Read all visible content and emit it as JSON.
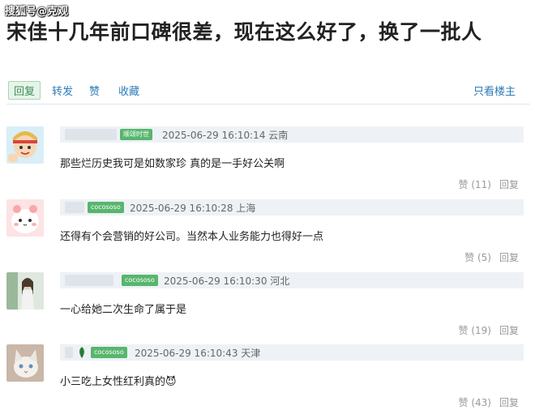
{
  "watermark": "搜狐号@克观",
  "article": {
    "title": "宋佳十几年前口碑很差，现在这么好了，换了一批人"
  },
  "actions": {
    "reply": "回复",
    "forward": "转发",
    "like": "赞",
    "favorite": "收藏",
    "only_op": "只看楼主"
  },
  "comments": [
    {
      "tag": "顺颂时世",
      "datetime": "2025-06-29 16:10:14",
      "location": "云南",
      "text": "那些烂历史我可是如数家珍 真的是一手好公关啊",
      "likes": "赞 (11)",
      "reply": "回复"
    },
    {
      "tag": "cocososo",
      "datetime": "2025-06-29 16:10:28",
      "location": "上海",
      "text": "还得有个会营销的好公司。当然本人业务能力也得好一点",
      "likes": "赞 (5)",
      "reply": "回复"
    },
    {
      "tag": "cocososo",
      "datetime": "2025-06-29 16:10:30",
      "location": "河北",
      "text": "一心给她二次生命了属于是",
      "likes": "赞 (19)",
      "reply": "回复"
    },
    {
      "tag": "cocososo",
      "datetime": "2025-06-29 16:10:43",
      "location": "天津",
      "text": "小三吃上女性红利真的",
      "emoji": "😈",
      "likes": "赞 (43)",
      "reply": "回复"
    }
  ],
  "colors": {
    "tag_green": "#57b66d",
    "link_blue": "#2d7bb8",
    "header_bar": "#eef2f6"
  }
}
